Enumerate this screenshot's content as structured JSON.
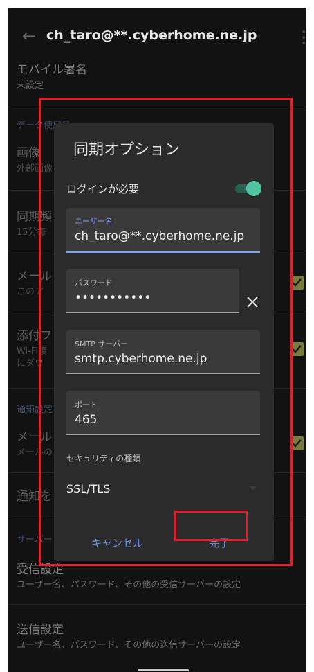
{
  "appbar": {
    "title": "ch_taro@**.cyberhome.ne.jp"
  },
  "background": {
    "mobile_signature": {
      "title": "モバイル署名",
      "sub": "未設定"
    },
    "data_usage_section": "データ使用量",
    "images": {
      "title": "画像",
      "sub": "外部画像"
    },
    "sync_frequency": {
      "title": "同期頻",
      "sub": "15分毎"
    },
    "mail": {
      "title": "メール",
      "sub": "このア"
    },
    "attachments": {
      "title": "添付フ",
      "sub1": "Wi-Fi接",
      "sub2": "にダウ"
    },
    "notification_section": "通知設定",
    "mail_notify": {
      "title": "メール",
      "sub": "メールの"
    },
    "notify_ringtone": {
      "title": "通知を"
    },
    "server_section": "サーバー",
    "incoming": {
      "title": "受信設定",
      "sub": "ユーザー名、パスワード、その他の受信サーバーの設定"
    },
    "outgoing": {
      "title": "送信設定",
      "sub": "ユーザー名、パスワード、その他の送信サーバーの設定"
    }
  },
  "dialog": {
    "title": "同期オプション",
    "login_required_label": "ログインが必要",
    "login_required": true,
    "username": {
      "label": "ユーザー名",
      "value": "ch_taro@**.cyberhome.ne.jp"
    },
    "password": {
      "label": "パスワード",
      "value": "•••••••••••"
    },
    "smtp_server": {
      "label": "SMTP サーバー",
      "value": "smtp.cyberhome.ne.jp"
    },
    "port": {
      "label": "ポート",
      "value": "465"
    },
    "security": {
      "label": "セキュリティの種類",
      "value": "SSL/TLS"
    },
    "cancel_label": "キャンセル",
    "done_label": "完了"
  },
  "colors": {
    "accent": "#6f8ad8",
    "toggle_on": "#4fc4a2",
    "highlight": "#e0212d",
    "checkbox": "#7a7b3c"
  },
  "icons": [
    "back-arrow-icon",
    "more-vert-icon",
    "clear-icon",
    "dropdown-arrow-icon",
    "checkbox-checked-icon"
  ]
}
